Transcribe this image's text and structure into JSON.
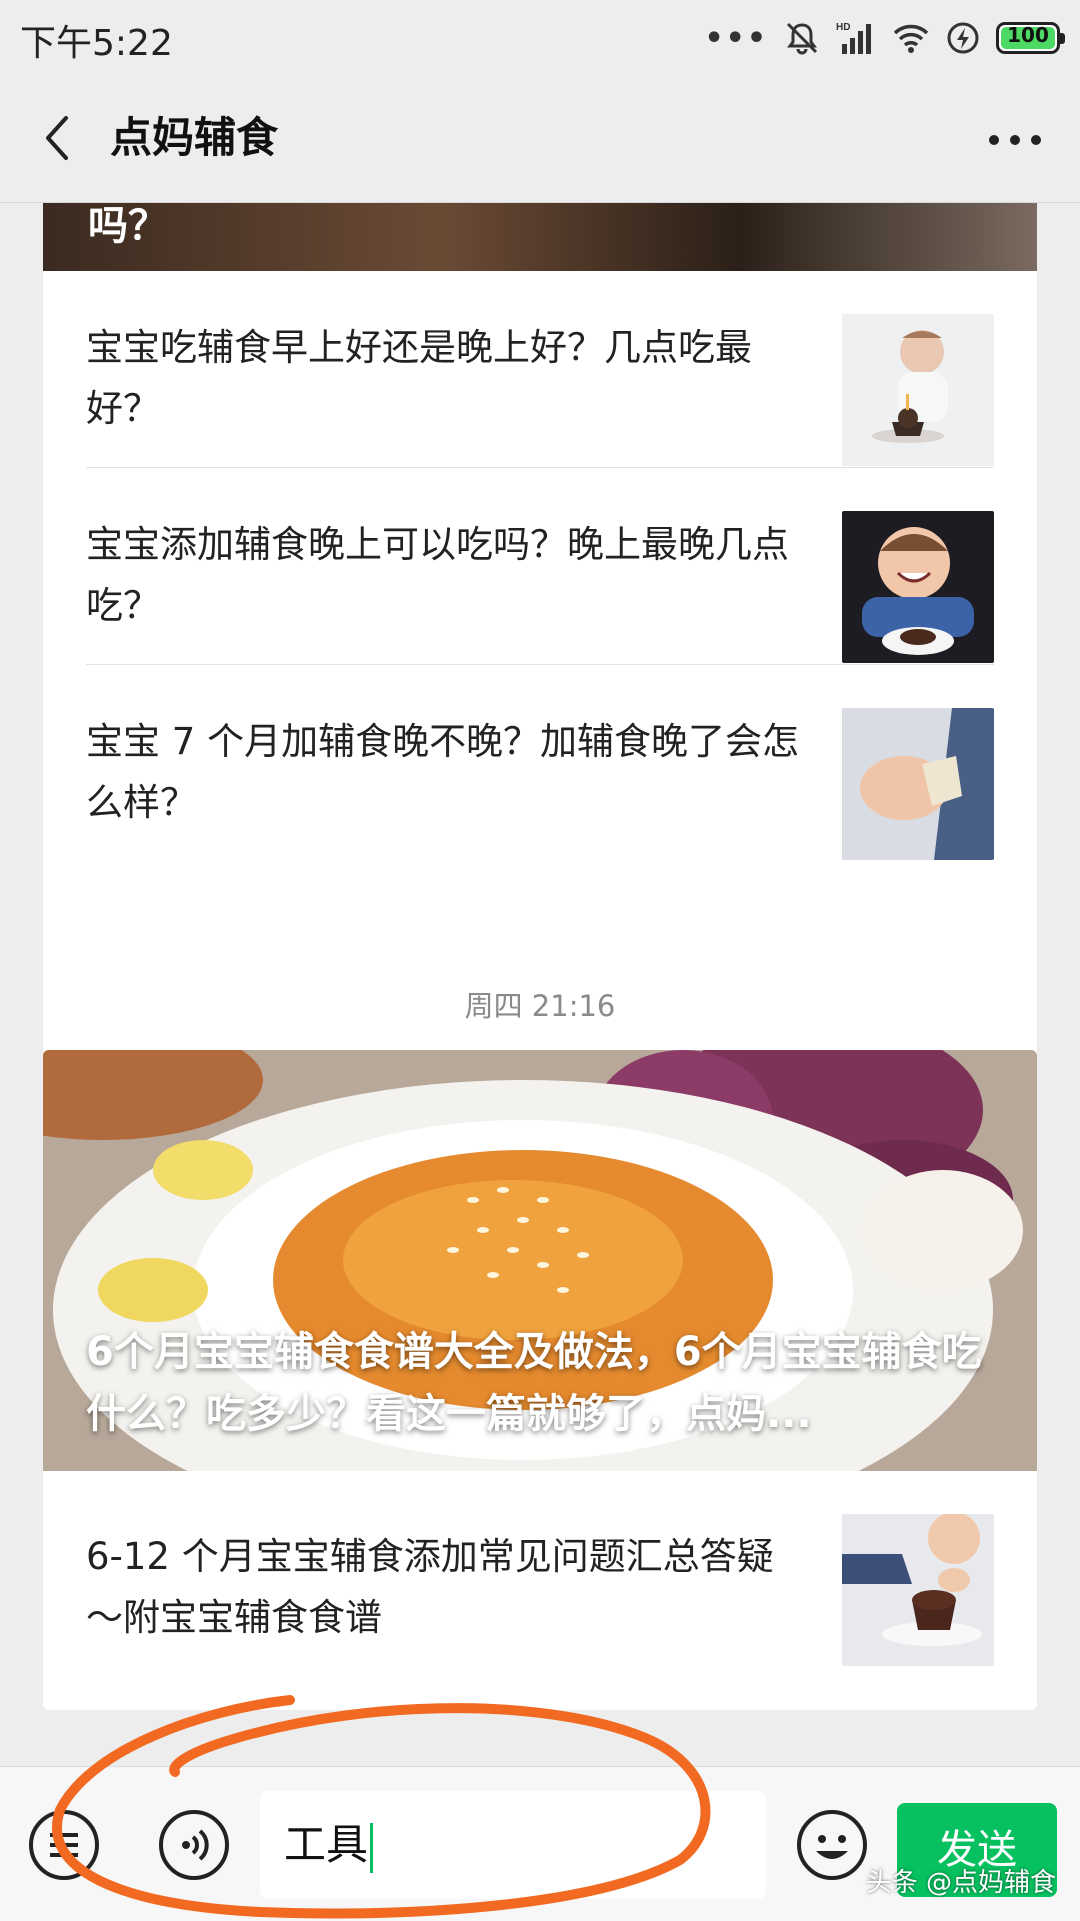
{
  "status_bar": {
    "time": "下午5:22",
    "battery": "100"
  },
  "header": {
    "title": "点妈辅食"
  },
  "card1": {
    "banner_tail": "吗？",
    "items": [
      {
        "title": "宝宝吃辅食早上好还是晚上好？几点吃最好？"
      },
      {
        "title": "宝宝添加辅食晚上可以吃吗？晚上最晚几点吃？"
      },
      {
        "title": "宝宝 7 个月加辅食晚不晚？加辅食晚了会怎么样？"
      }
    ]
  },
  "timestamp": "周四 21:16",
  "card2": {
    "hero_title": "6个月宝宝辅食食谱大全及做法，6个月宝宝辅食吃什么？吃多少？看这一篇就够了，点妈...",
    "items": [
      {
        "title": "6-12 个月宝宝辅食添加常见问题汇总答疑～附宝宝辅食食谱"
      }
    ]
  },
  "input_bar": {
    "value": "工具",
    "send_label": "发送"
  },
  "watermark": "头条 @点妈辅食",
  "colors": {
    "accent": "#07c160",
    "background": "#ededed",
    "annotation": "#f26a21"
  }
}
